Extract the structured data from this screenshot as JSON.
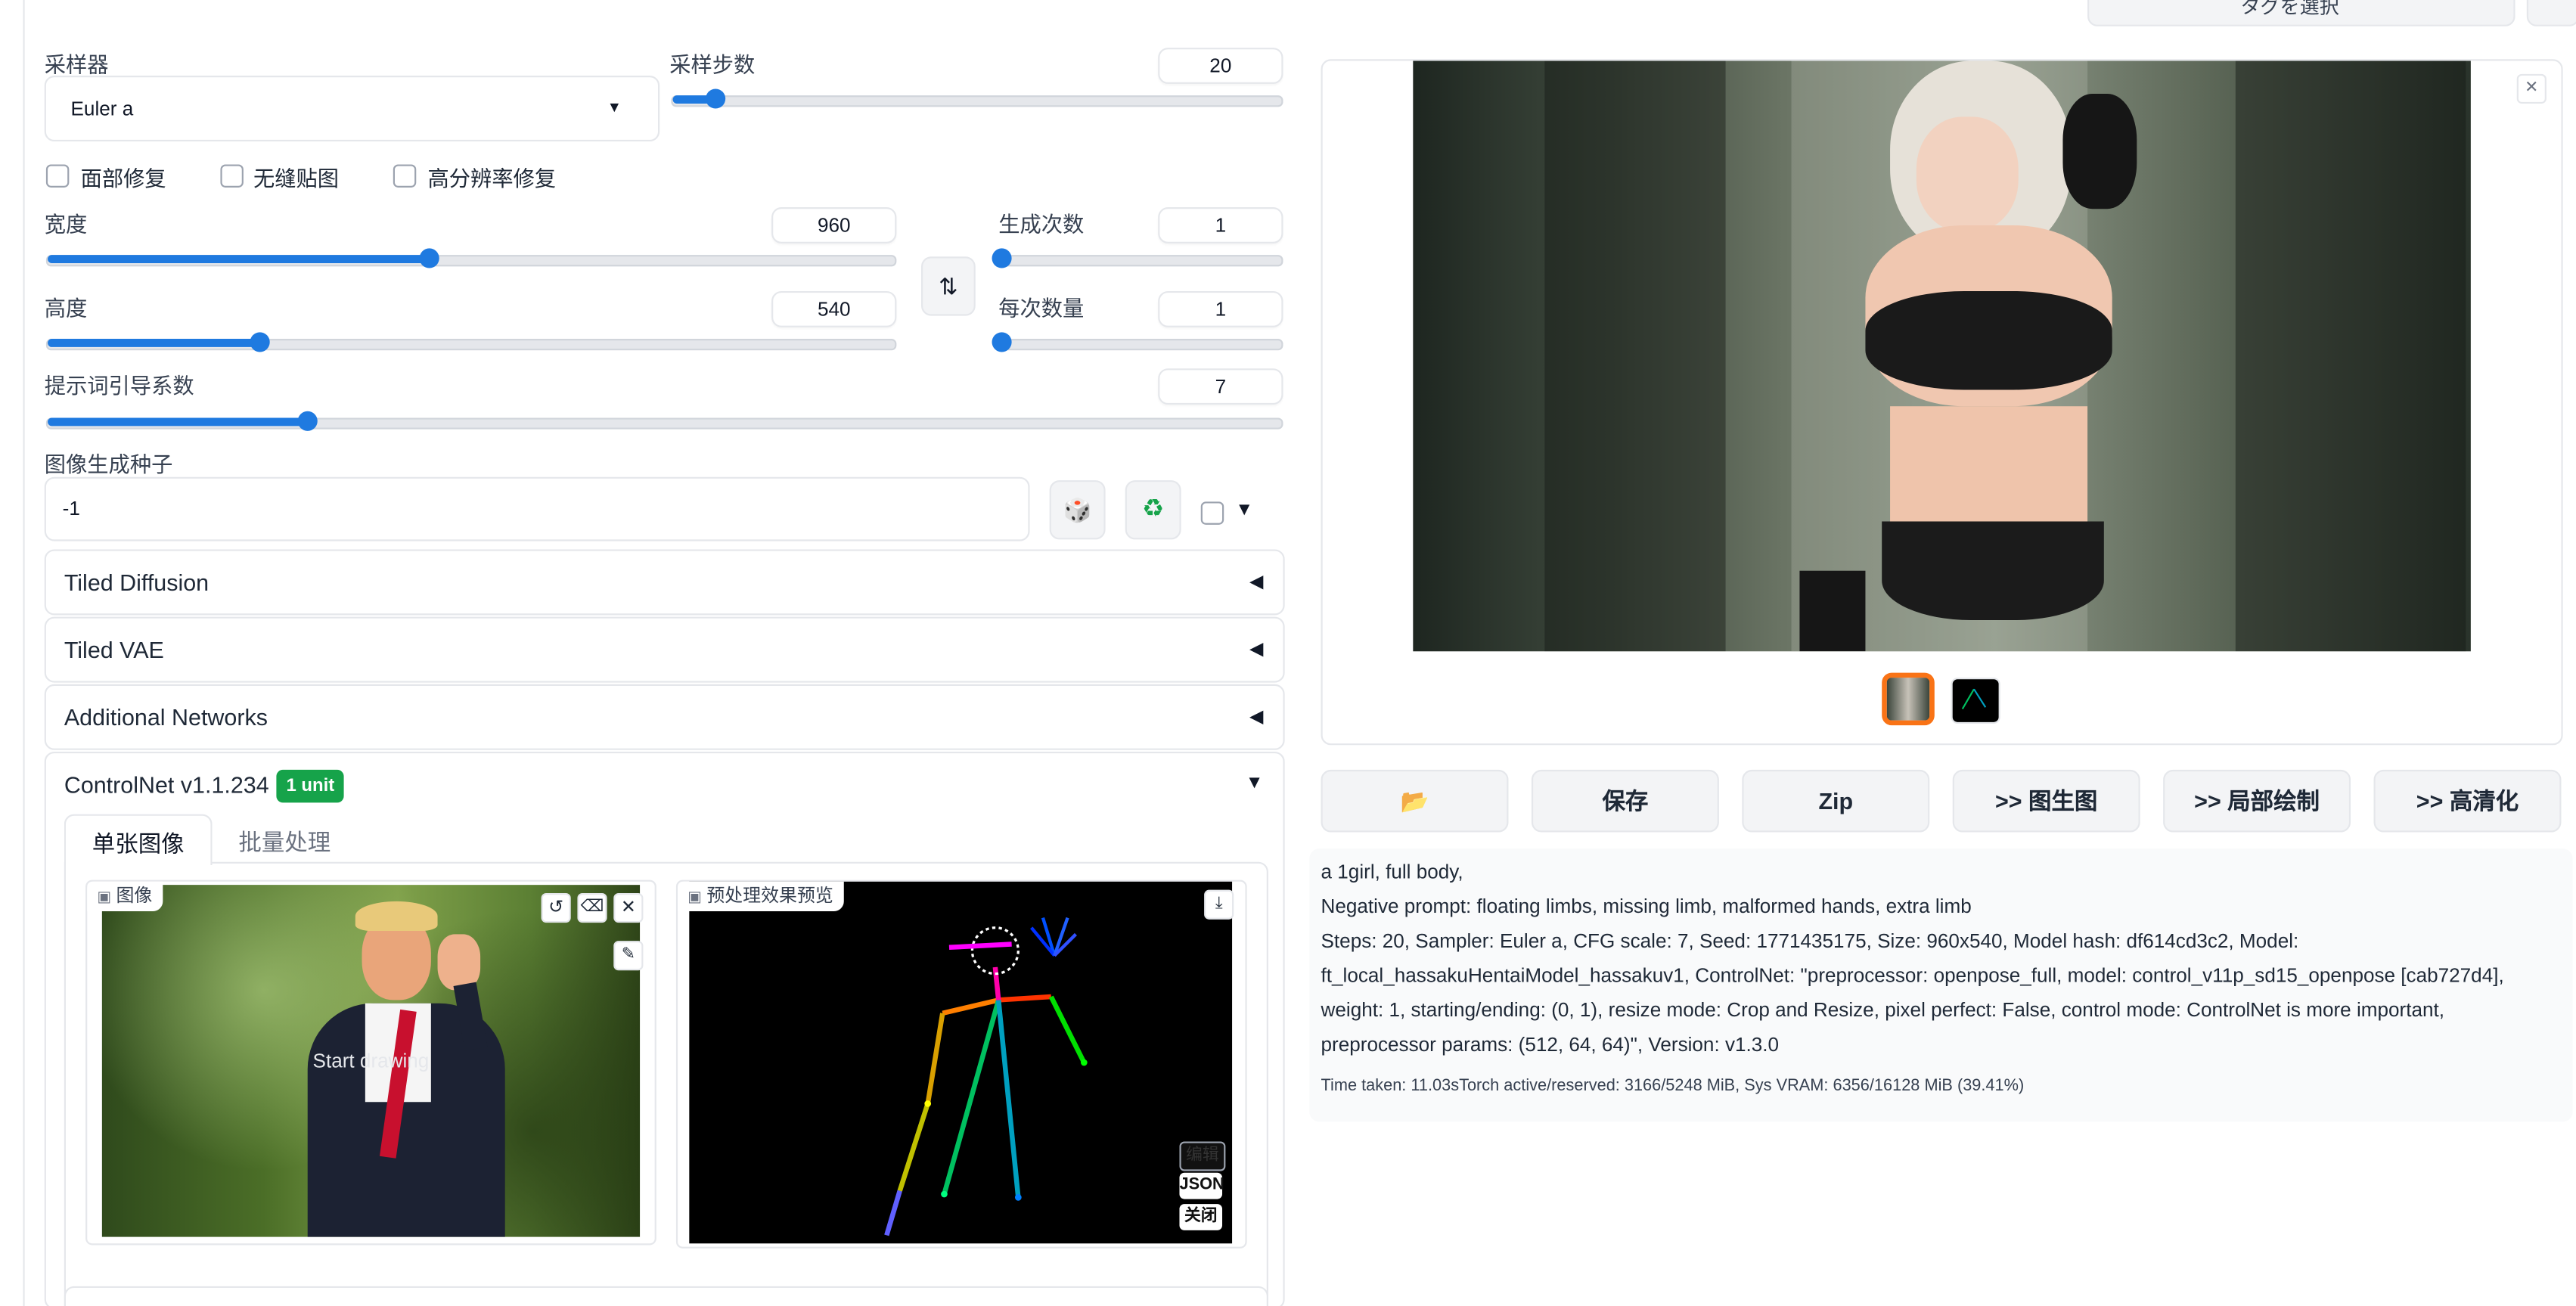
{
  "top": {
    "partial_button_label": "タグを選択"
  },
  "sampler": {
    "label": "采样器",
    "value": "Euler a"
  },
  "steps": {
    "label": "采样步数",
    "value": "20",
    "fraction": 0.07
  },
  "checkboxes": [
    "面部修复",
    "无缝贴图",
    "高分辨率修复"
  ],
  "width": {
    "label": "宽度",
    "value": "960",
    "fraction": 0.45
  },
  "height": {
    "label": "高度",
    "value": "540",
    "fraction": 0.25
  },
  "batch_count": {
    "label": "生成次数",
    "value": "1",
    "fraction": 0.0
  },
  "batch_size": {
    "label": "每次数量",
    "value": "1",
    "fraction": 0.0
  },
  "cfg": {
    "label": "提示词引导系数",
    "value": "7",
    "fraction": 0.21
  },
  "seed": {
    "label": "图像生成种子",
    "value": "-1"
  },
  "accordions": {
    "tiled_diffusion": "Tiled Diffusion",
    "tiled_vae": "Tiled VAE",
    "additional_networks": "Additional Networks",
    "controlnet": "ControlNet v1.1.234",
    "controlnet_badge": "1 unit"
  },
  "controlnet_tabs": [
    "单张图像",
    "批量处理"
  ],
  "image_panel": {
    "label": "图像",
    "overlay_text": "Start drawing"
  },
  "preview_panel": {
    "label": "预处理效果预览",
    "buttons": [
      "编辑",
      "JSON",
      "关闭"
    ]
  },
  "output_buttons": [
    "保存",
    "Zip",
    ">> 图生图",
    ">> 局部绘制",
    ">> 高清化"
  ],
  "info": {
    "line1": "a 1girl, full body,",
    "line2": "Negative prompt: floating limbs, missing limb, malformed hands, extra limb",
    "line3": "Steps: 20, Sampler: Euler a, CFG scale: 7, Seed: 1771435175, Size: 960x540, Model hash: df614cd3c2, Model:",
    "line4": "ft_local_hassakuHentaiModel_hassakuv1, ControlNet: \"preprocessor: openpose_full, model: control_v11p_sd15_openpose [cab727d4],",
    "line5": "weight: 1, starting/ending: (0, 1), resize mode: Crop and Resize, pixel perfect: False, control mode: ControlNet is more important,",
    "line6": "preprocessor params: (512, 64, 64)\", Version: v1.3.0",
    "time": "Time taken: 11.03sTorch active/reserved: 3166/5248 MiB, Sys VRAM: 6356/16128 MiB (39.41%)"
  },
  "colors": {
    "accent": "#1f7ae0",
    "badge": "#16a34a",
    "thumb_selected": "#f97316"
  },
  "icons": [
    "dice-icon",
    "recycle-icon",
    "swap-icon",
    "folder-icon",
    "close-icon",
    "undo-icon",
    "eraser-icon",
    "brush-icon",
    "download-icon",
    "image-icon"
  ]
}
